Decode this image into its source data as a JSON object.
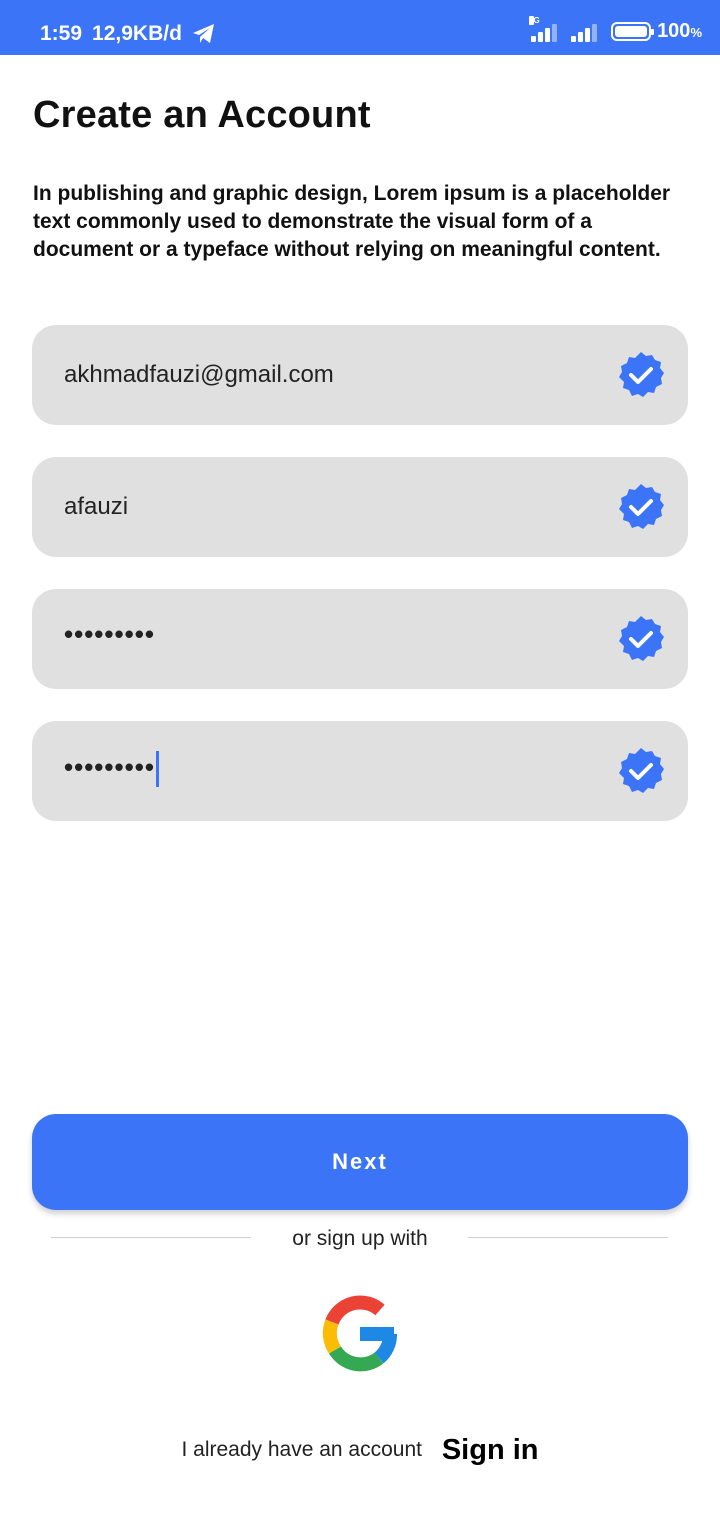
{
  "status_bar": {
    "time": "1:59",
    "speed": "12,9KB/d",
    "network_type": "4G",
    "battery": "100",
    "battery_unit": "%",
    "app_icon": "telegram-icon"
  },
  "page": {
    "title": "Create an Account",
    "description": "In publishing and graphic design, Lorem ipsum is a placeholder text commonly used to demonstrate the visual form of a document or a typeface without relying on meaningful content."
  },
  "form": {
    "email": "akhmadfauzi@gmail.com",
    "username": "afauzi",
    "password": "•••••••••",
    "confirm_password": "•••••••••",
    "valid_icon": "verified-check-icon"
  },
  "actions": {
    "next_label": "Next",
    "or_text": "or sign up with",
    "google_icon": "google-icon",
    "have_account": "I already have an account",
    "sign_in": "Sign in"
  },
  "colors": {
    "accent": "#3b74f6",
    "field_bg": "#e0e0e0"
  }
}
